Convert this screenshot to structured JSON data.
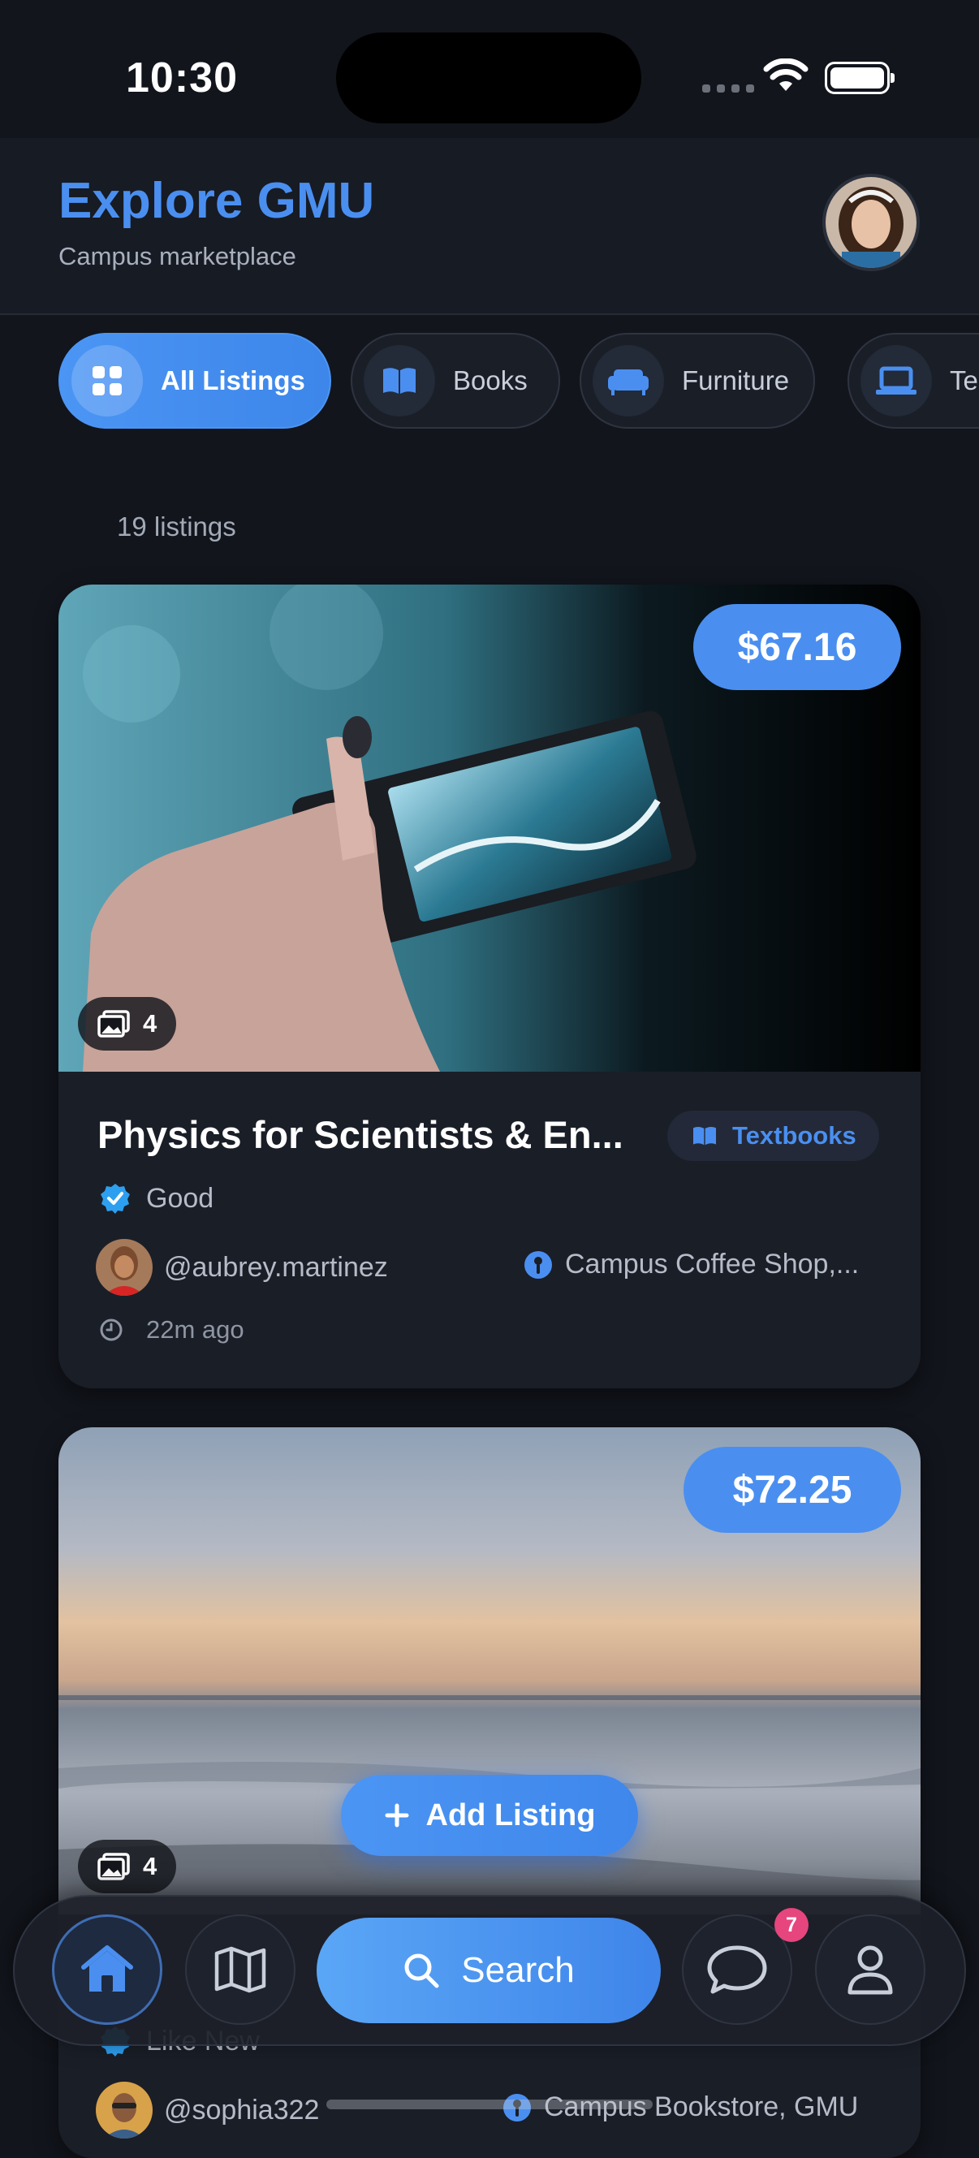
{
  "status": {
    "time": "10:30"
  },
  "header": {
    "title": "Explore GMU",
    "subtitle": "Campus marketplace"
  },
  "categories": [
    {
      "label": "All Listings",
      "icon": "grid-icon",
      "active": true
    },
    {
      "label": "Books",
      "icon": "book-icon",
      "active": false
    },
    {
      "label": "Furniture",
      "icon": "sofa-icon",
      "active": false
    },
    {
      "label": "Te",
      "icon": "laptop-icon",
      "active": false
    }
  ],
  "listing_count": "19 listings",
  "listings": [
    {
      "price": "$67.16",
      "photos": "4",
      "title": "Physics for Scientists & En...",
      "category": "Textbooks",
      "condition": "Good",
      "seller": "@aubrey.martinez",
      "location": "Campus Coffee Shop,...",
      "posted": "22m ago"
    },
    {
      "price": "$72.25",
      "photos": "4",
      "condition": "Like New",
      "seller": "@sophia322",
      "location": "Campus Bookstore, GMU"
    }
  ],
  "add_listing": "Add Listing",
  "nav": {
    "search": "Search",
    "messages_badge": "7"
  },
  "colors": {
    "accent": "#4a8ff0",
    "background": "#12151c",
    "badge": "#e6457e"
  }
}
